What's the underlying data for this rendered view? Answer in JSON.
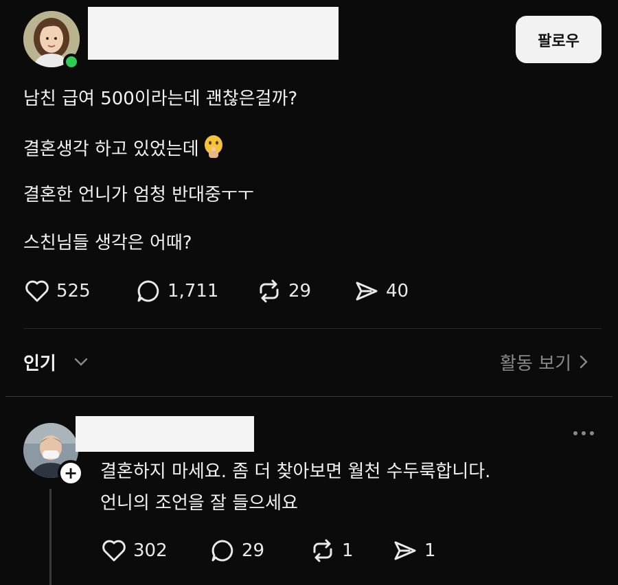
{
  "post": {
    "follow_label": "팔로우",
    "lines": [
      "남친 급여 500이라는데 괜찮은걸까?",
      "결혼생각 하고 있었는데",
      "결혼한 언니가 엄청 반대중ㅜㅜ",
      "스친님들 생각은 어때?"
    ],
    "emoji": "shushing-face",
    "stats": {
      "likes": "525",
      "comments": "1,711",
      "reposts": "29",
      "shares": "40"
    }
  },
  "sort": {
    "label": "인기",
    "activity": "활동 보기"
  },
  "reply": {
    "lines": [
      "결혼하지 마세요. 좀 더 찾아보면 월천 수두룩합니다.",
      "언니의 조언을 잘 들으세요"
    ],
    "stats": {
      "likes": "302",
      "comments": "29",
      "reposts": "1",
      "shares": "1"
    }
  },
  "colors": {
    "background": "#0b0b0b",
    "online": "#2ecc55",
    "muted": "#8a8a8a"
  }
}
